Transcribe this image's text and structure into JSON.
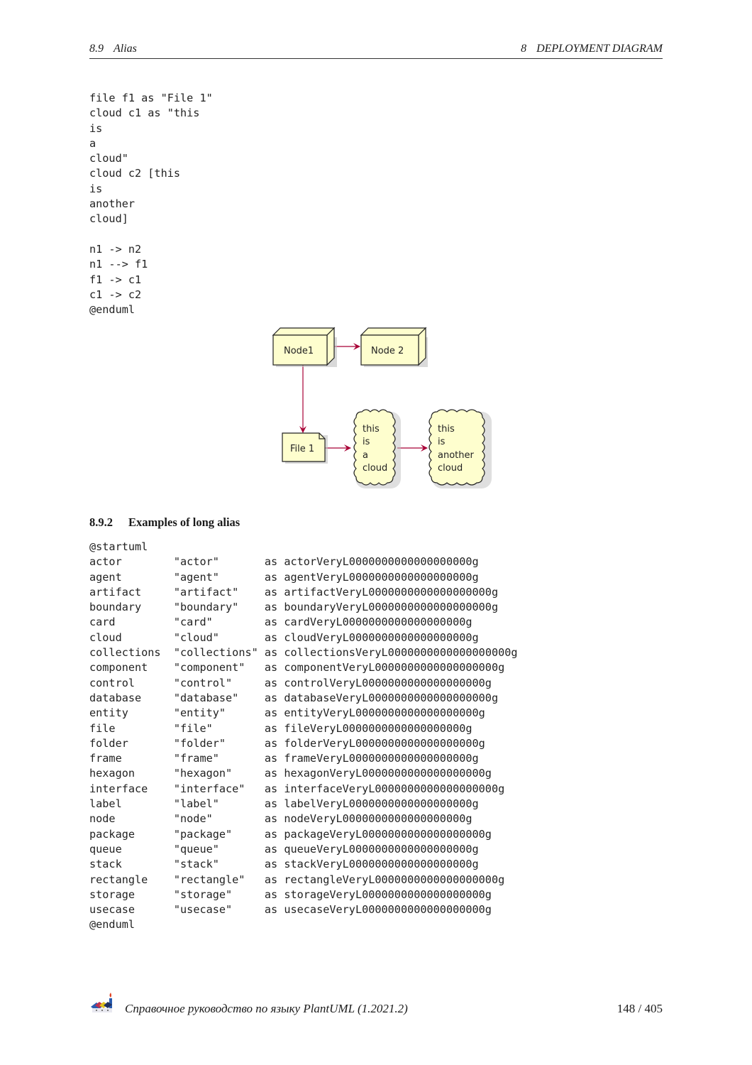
{
  "header": {
    "section_number": "8.9",
    "section_title": "Alias",
    "chapter_number": "8",
    "chapter_title": "DEPLOYMENT DIAGRAM"
  },
  "code_block_1": [
    "file f1 as \"File 1\"",
    "cloud c1 as \"this",
    "is",
    "a",
    "cloud\"",
    "cloud c2 [this",
    "is",
    "another",
    "cloud]",
    "",
    "n1 -> n2",
    "n1 --> f1",
    "f1 -> c1",
    "c1 -> c2",
    "@enduml"
  ],
  "diagram": {
    "colors": {
      "fill": "#FEFECE",
      "stroke": "#222222",
      "arrow": "#A80036",
      "shadow": "#C0C0C0"
    },
    "nodes": [
      {
        "id": "n1",
        "type": "node",
        "label": "Node1"
      },
      {
        "id": "n2",
        "type": "node",
        "label": "Node 2"
      },
      {
        "id": "f1",
        "type": "file",
        "label": "File 1"
      },
      {
        "id": "c1",
        "type": "cloud",
        "lines": [
          "this",
          "is",
          "a",
          "cloud"
        ]
      },
      {
        "id": "c2",
        "type": "cloud",
        "lines": [
          "this",
          "is",
          "another",
          "cloud"
        ]
      }
    ],
    "edges": [
      {
        "from": "n1",
        "to": "n2"
      },
      {
        "from": "n1",
        "to": "f1"
      },
      {
        "from": "f1",
        "to": "c1"
      },
      {
        "from": "c1",
        "to": "c2"
      }
    ]
  },
  "section": {
    "number": "8.9.2",
    "title": "Examples of long alias"
  },
  "code_block_2": {
    "start": "@startuml",
    "end": "@enduml",
    "keyword": "as",
    "rows": [
      {
        "type": "actor",
        "label": "\"actor\"",
        "alias": "actorVeryL0000000000000000000g"
      },
      {
        "type": "agent",
        "label": "\"agent\"",
        "alias": "agentVeryL0000000000000000000g"
      },
      {
        "type": "artifact",
        "label": "\"artifact\"",
        "alias": "artifactVeryL0000000000000000000g"
      },
      {
        "type": "boundary",
        "label": "\"boundary\"",
        "alias": "boundaryVeryL0000000000000000000g"
      },
      {
        "type": "card",
        "label": "\"card\"",
        "alias": "cardVeryL0000000000000000000g"
      },
      {
        "type": "cloud",
        "label": "\"cloud\"",
        "alias": "cloudVeryL0000000000000000000g"
      },
      {
        "type": "collections",
        "label": "\"collections\"",
        "alias": "collectionsVeryL0000000000000000000g"
      },
      {
        "type": "component",
        "label": "\"component\"",
        "alias": "componentVeryL0000000000000000000g"
      },
      {
        "type": "control",
        "label": "\"control\"",
        "alias": "controlVeryL0000000000000000000g"
      },
      {
        "type": "database",
        "label": "\"database\"",
        "alias": "databaseVeryL0000000000000000000g"
      },
      {
        "type": "entity",
        "label": "\"entity\"",
        "alias": "entityVeryL0000000000000000000g"
      },
      {
        "type": "file",
        "label": "\"file\"",
        "alias": "fileVeryL0000000000000000000g"
      },
      {
        "type": "folder",
        "label": "\"folder\"",
        "alias": "folderVeryL0000000000000000000g"
      },
      {
        "type": "frame",
        "label": "\"frame\"",
        "alias": "frameVeryL0000000000000000000g"
      },
      {
        "type": "hexagon",
        "label": "\"hexagon\"",
        "alias": "hexagonVeryL0000000000000000000g"
      },
      {
        "type": "interface",
        "label": "\"interface\"",
        "alias": "interfaceVeryL0000000000000000000g"
      },
      {
        "type": "label",
        "label": "\"label\"",
        "alias": "labelVeryL0000000000000000000g"
      },
      {
        "type": "node",
        "label": "\"node\"",
        "alias": "nodeVeryL0000000000000000000g"
      },
      {
        "type": "package",
        "label": "\"package\"",
        "alias": "packageVeryL0000000000000000000g"
      },
      {
        "type": "queue",
        "label": "\"queue\"",
        "alias": "queueVeryL0000000000000000000g"
      },
      {
        "type": "stack",
        "label": "\"stack\"",
        "alias": "stackVeryL0000000000000000000g"
      },
      {
        "type": "rectangle",
        "label": "\"rectangle\"",
        "alias": "rectangleVeryL0000000000000000000g"
      },
      {
        "type": "storage",
        "label": "\"storage\"",
        "alias": "storageVeryL0000000000000000000g"
      },
      {
        "type": "usecase",
        "label": "\"usecase\"",
        "alias": "usecaseVeryL0000000000000000000g"
      }
    ]
  },
  "footer": {
    "logo_icon": "plantuml-logo-icon",
    "title": "Справочное руководство по языку PlantUML (1.2021.2)",
    "page": "148 / 405"
  }
}
